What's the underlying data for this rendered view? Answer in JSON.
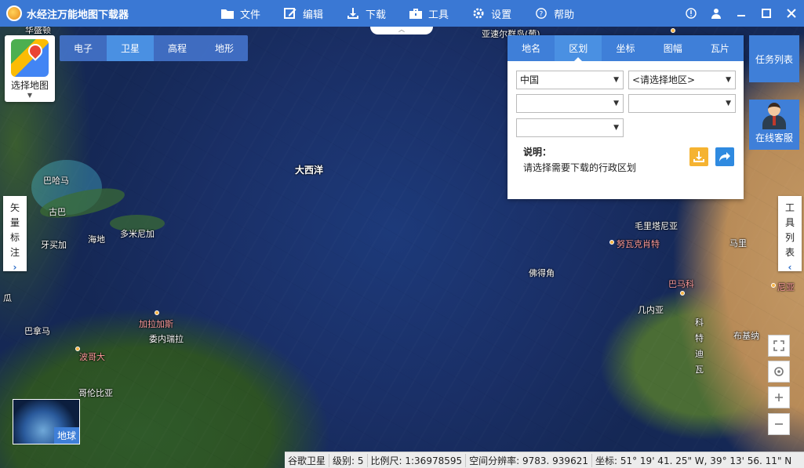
{
  "app": {
    "title": "水经注万能地图下载器"
  },
  "menu": [
    {
      "label": "文件",
      "icon": "folder-icon"
    },
    {
      "label": "编辑",
      "icon": "edit-icon"
    },
    {
      "label": "下载",
      "icon": "download-icon"
    },
    {
      "label": "工具",
      "icon": "toolbox-icon"
    },
    {
      "label": "设置",
      "icon": "gear-icon"
    },
    {
      "label": "帮助",
      "icon": "help-icon"
    }
  ],
  "window_controls": {
    "info": "!",
    "user": "user-icon",
    "minimize": "—",
    "maximize": "□",
    "close": "✕"
  },
  "select_map": {
    "label": "选择地图"
  },
  "map_types": [
    "电子",
    "卫星",
    "高程",
    "地形"
  ],
  "active_map_type": "卫星",
  "panel": {
    "tabs": [
      "地名",
      "区划",
      "坐标",
      "图幅",
      "瓦片"
    ],
    "active_tab": "区划",
    "country": "中国",
    "region_placeholder": "<请选择地区>",
    "desc_title": "说明：",
    "desc_text": "请选择需要下载的行政区划"
  },
  "right_buttons": {
    "task_list": "任务列表",
    "online_service": "在线客服"
  },
  "side_tabs": {
    "left": [
      "矢",
      "量",
      "标",
      "注"
    ],
    "right": [
      "工",
      "具",
      "列",
      "表"
    ]
  },
  "map_labels": {
    "atlantic": "大西洋",
    "azores": "亚速尔群岛(葡)",
    "bahamas": "巴哈马",
    "cuba": "古巴",
    "jamaica": "牙买加",
    "haiti": "海地",
    "dominican": "多米尼加",
    "panama": "巴拿马",
    "caracas": "加拉加斯",
    "venezuela": "委内瑞拉",
    "bogota": "波哥大",
    "colombia": "哥伦比亚",
    "cape_verde": "佛得角",
    "mauritania": "毛里塔尼亚",
    "nouakchott": "努瓦克肖特",
    "mali": "马里",
    "bamako": "巴马科",
    "guinea": "几内亚",
    "ivory_coast": "科特迪瓦",
    "burkina": "布基纳",
    "niger_partial": "尼亚",
    "washington_partial": "华盛顿",
    "left_partial": "瓜"
  },
  "globe": {
    "label": "地球"
  },
  "status": {
    "source": "谷歌卫星",
    "level": "级别: 5",
    "scale": "比例尺: 1:36978595",
    "resolution": "空间分辨率: 9783. 939621",
    "coords": "坐标: 51° 19' 41. 25\" W, 39° 13' 56. 11\" N"
  }
}
